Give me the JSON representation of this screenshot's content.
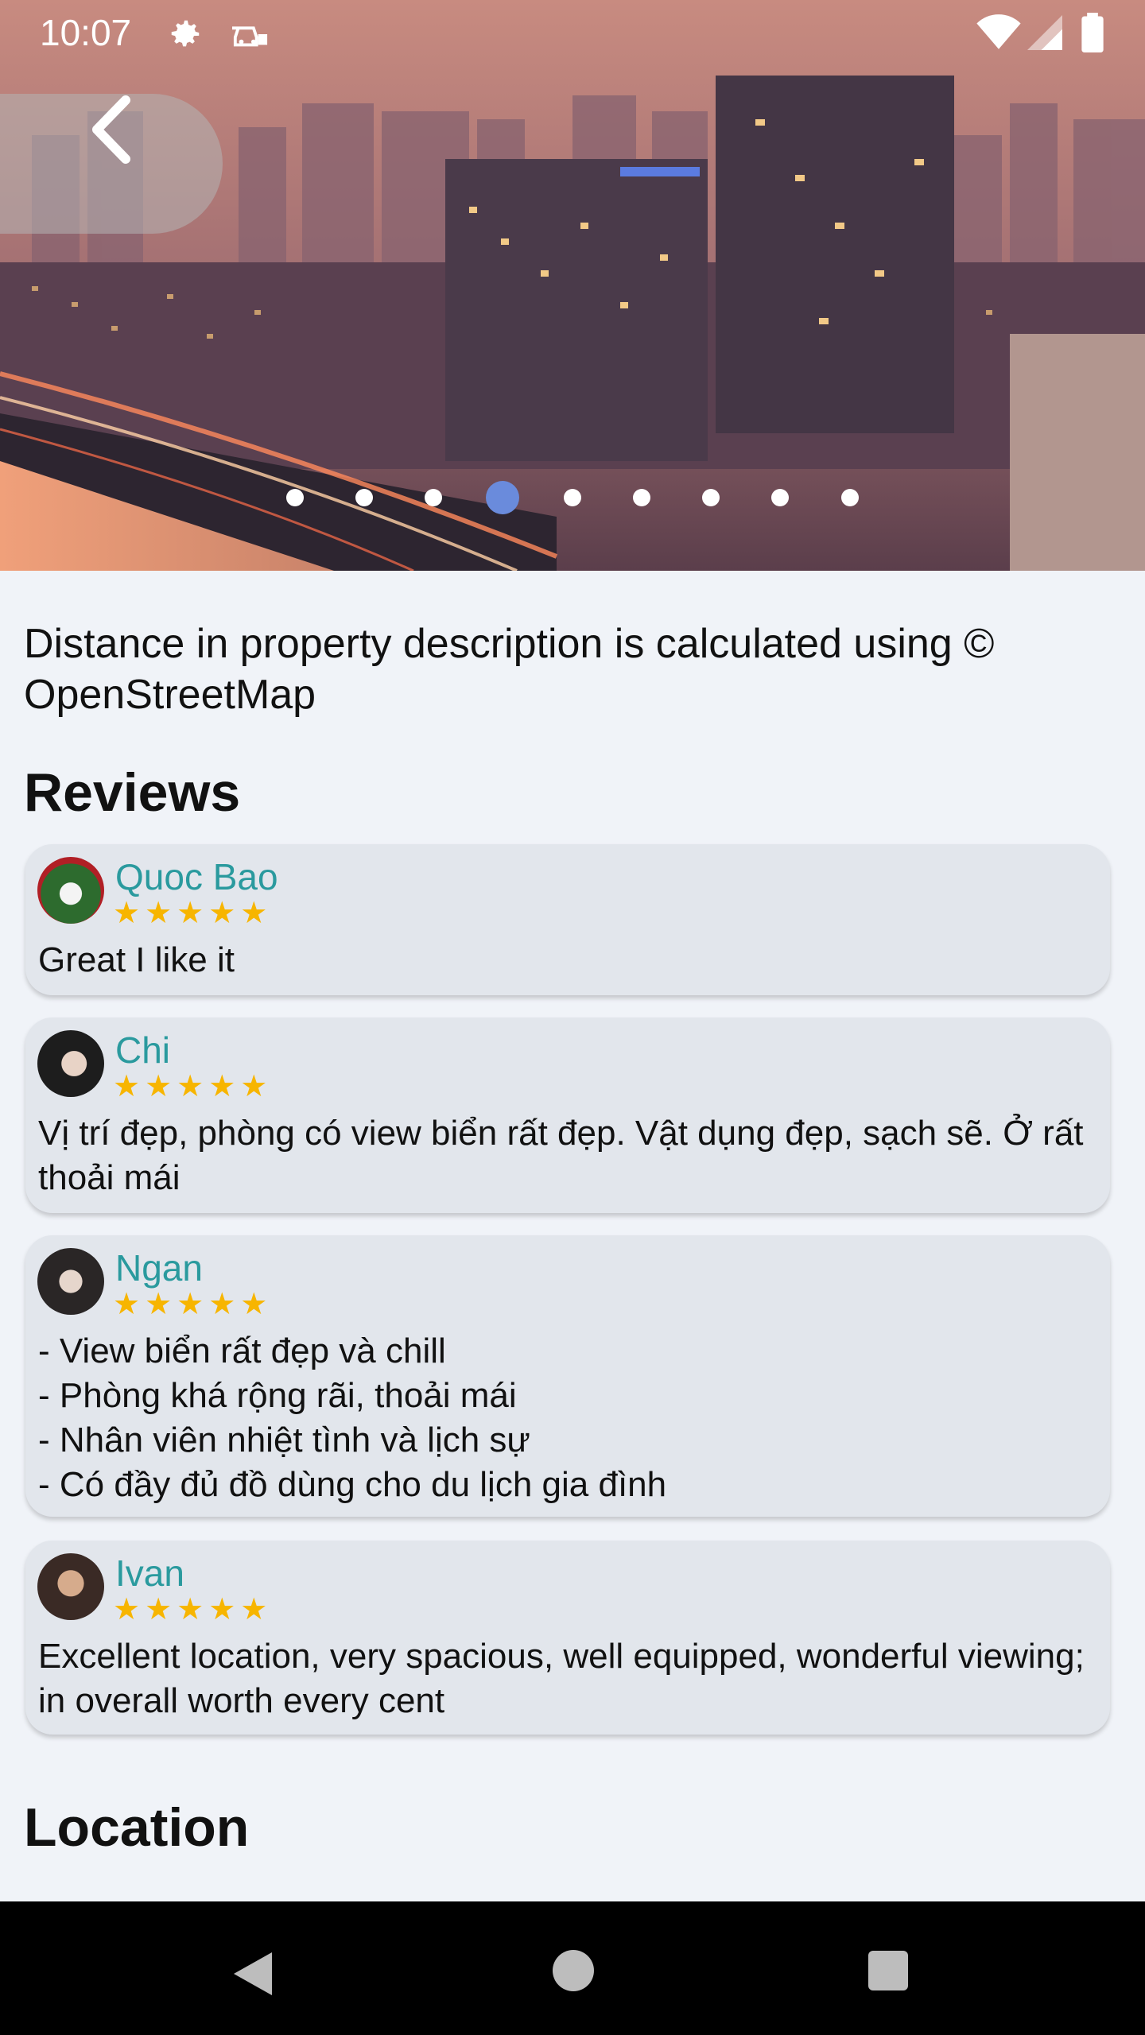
{
  "status_bar": {
    "time": "10:07",
    "icons": [
      "gear-icon",
      "car-icon",
      "wifi-icon",
      "signal-icon",
      "battery-icon"
    ]
  },
  "hero": {
    "image_alt": "city skyline",
    "carousel_total": 9,
    "carousel_active_index": 3
  },
  "attribution": "Distance in property description is calculated using © OpenStreetMap",
  "reviews": {
    "title": "Reviews",
    "items": [
      {
        "name": "Quoc Bao",
        "stars": "★★★★★",
        "rating": 5,
        "text": "Great I like it"
      },
      {
        "name": "Chi",
        "stars": "★★★★★",
        "rating": 5,
        "text": "Vị trí đẹp, phòng có view biển rất đẹp. Vật dụng đẹp, sạch sẽ. Ở rất thoải mái"
      },
      {
        "name": "Ngan",
        "stars": "★★★★★",
        "rating": 5,
        "text": "- View biển rất đẹp và chill\n- Phòng khá rộng rãi, thoải mái\n- Nhân viên nhiệt tình và lịch sự\n- Có đầy đủ đồ dùng cho du lịch gia đình"
      },
      {
        "name": "Ivan",
        "stars": "★★★★★",
        "rating": 5,
        "text": "Excellent location, very spacious, well equipped, wonderful viewing; in overall worth every cent"
      }
    ]
  },
  "location": {
    "title": "Location"
  },
  "colors": {
    "accent_name": "#2a9a9e",
    "star": "#f7b500",
    "active_dot": "#6a8bdc",
    "background": "#f0f3f8",
    "card": "#e2e6ec"
  }
}
